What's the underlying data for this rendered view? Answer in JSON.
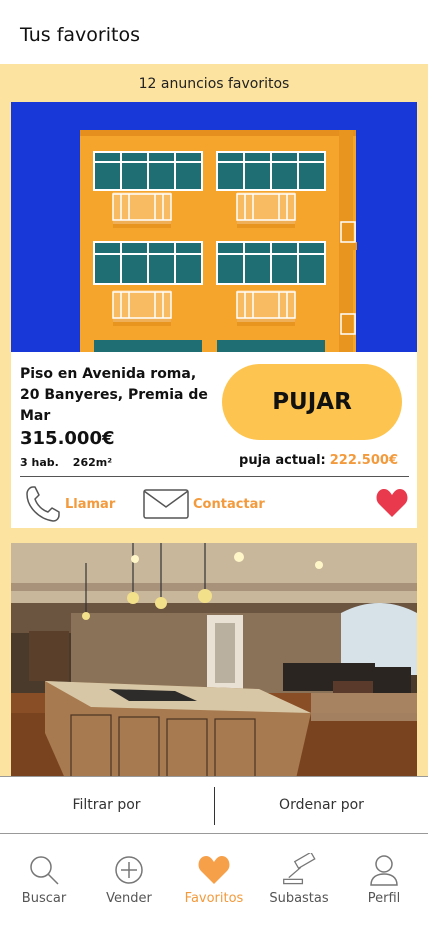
{
  "header": {
    "title": "Tus favoritos"
  },
  "favorites": {
    "count_label": "12 anuncios favoritos"
  },
  "listings": [
    {
      "title": "Piso en Avenida roma, 20 Banyeres, Premia de Mar",
      "price": "315.000€",
      "rooms": "3 hab.",
      "area": "262m²",
      "bid_button": "PUJAR",
      "current_bid_label": "puja actual:",
      "current_bid_value": "222.500€",
      "call_label": "Llamar",
      "contact_label": "Contactar"
    }
  ],
  "filter_bar": {
    "filter_label": "Filtrar por",
    "sort_label": "Ordenar por"
  },
  "nav": [
    {
      "label": "Buscar",
      "icon": "search-icon"
    },
    {
      "label": "Vender",
      "icon": "plus-circle-icon"
    },
    {
      "label": "Favoritos",
      "icon": "heart-icon",
      "active": true
    },
    {
      "label": "Subastas",
      "icon": "gavel-icon"
    },
    {
      "label": "Perfil",
      "icon": "user-icon"
    }
  ],
  "colors": {
    "accent": "#f39a3c",
    "button": "#fdc54f",
    "background": "#fce3a0",
    "heart": "#e8394d"
  }
}
